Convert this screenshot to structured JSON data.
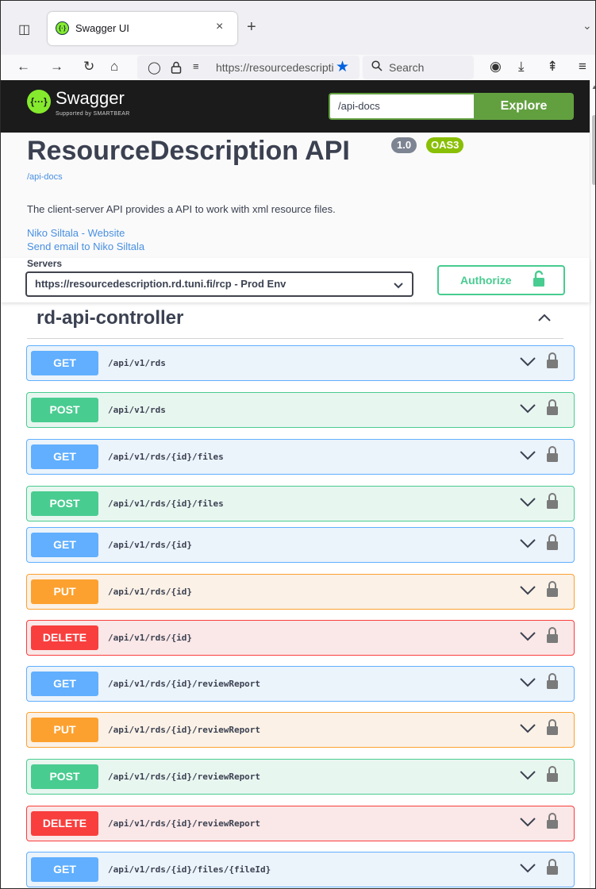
{
  "browser": {
    "tab_title": "Swagger UI",
    "tab_close": "×",
    "new_tab": "+",
    "url": "https://resourcedescription.rd.tuni.fi/rcp",
    "search_placeholder": "Search"
  },
  "header": {
    "logo_text": "Swagger",
    "logo_sub": "Supported by SMARTBEAR",
    "spec_url": "/api-docs",
    "explore_label": "Explore"
  },
  "info": {
    "title": "ResourceDescription API",
    "version": "1.0",
    "oas": "OAS3",
    "docs_link": "/api-docs",
    "description": "The client-server API provides a API to work with xml resource files.",
    "contact_website": "Niko Siltala - Website",
    "contact_email": "Send email to Niko Siltala"
  },
  "servers": {
    "label": "Servers",
    "selected": "https://resourcedescription.rd.tuni.fi/rcp - Prod Env",
    "authorize_label": "Authorize"
  },
  "tag": {
    "name": "rd-api-controller"
  },
  "operations": [
    {
      "method": "GET",
      "path": "/api/v1/rds"
    },
    {
      "method": "POST",
      "path": "/api/v1/rds"
    },
    {
      "method": "GET",
      "path": "/api/v1/rds/{id}/files"
    },
    {
      "method": "POST",
      "path": "/api/v1/rds/{id}/files"
    },
    {
      "method": "GET",
      "path": "/api/v1/rds/{id}"
    },
    {
      "method": "PUT",
      "path": "/api/v1/rds/{id}"
    },
    {
      "method": "DELETE",
      "path": "/api/v1/rds/{id}"
    },
    {
      "method": "GET",
      "path": "/api/v1/rds/{id}/reviewReport"
    },
    {
      "method": "PUT",
      "path": "/api/v1/rds/{id}/reviewReport"
    },
    {
      "method": "POST",
      "path": "/api/v1/rds/{id}/reviewReport"
    },
    {
      "method": "DELETE",
      "path": "/api/v1/rds/{id}/reviewReport"
    },
    {
      "method": "GET",
      "path": "/api/v1/rds/{id}/files/{fileId}"
    }
  ],
  "colors": {
    "get": "#61affe",
    "post": "#49cc90",
    "put": "#fca130",
    "delete": "#f93e3e",
    "swagger_green": "#85ea2d",
    "header_bg": "#1b1b1b"
  }
}
